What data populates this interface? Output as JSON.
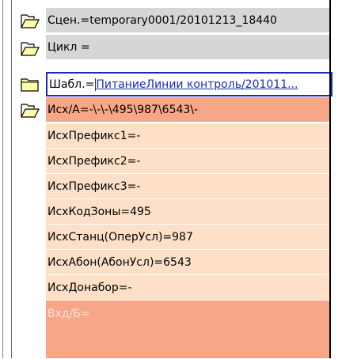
{
  "colors": {
    "gray_row": "#d6d6d6",
    "salmon_row": "#f8a688",
    "peach_row": "#fde0c7",
    "link_blue": "#1a2ab8",
    "faded_text": "#f7e2d6",
    "folder_fill": "#ffffa8"
  },
  "rows": [
    {
      "type": "node",
      "icon": "open-folder-icon",
      "text": "Сцен.=temporary0001/20101213_18440"
    },
    {
      "type": "node",
      "icon": "open-folder-icon",
      "text": "Цикл ="
    },
    {
      "type": "selected",
      "icon": "closed-folder-icon",
      "label": "Шабл.=",
      "value": "ПитаниеЛинии контроль/201011..."
    },
    {
      "type": "node",
      "icon": "open-folder-icon",
      "text": "Исх/А=-\\-\\-\\495\\987\\6543\\-"
    },
    {
      "type": "leaf",
      "text": "ИсхПрефикс1=-"
    },
    {
      "type": "leaf",
      "text": "ИсхПрефикс2=-"
    },
    {
      "type": "leaf",
      "text": "ИсхПрефикс3=-"
    },
    {
      "type": "leaf",
      "text": "ИсхКодЗоны=495"
    },
    {
      "type": "leaf",
      "text": "ИсхСтанц(ОперУсл)=987"
    },
    {
      "type": "leaf",
      "text": "ИсхАбон(АбонУсл)=6543"
    },
    {
      "type": "leaf",
      "text": "ИсхДонабор=-"
    },
    {
      "type": "faded",
      "text": "Вхд/Б="
    }
  ]
}
